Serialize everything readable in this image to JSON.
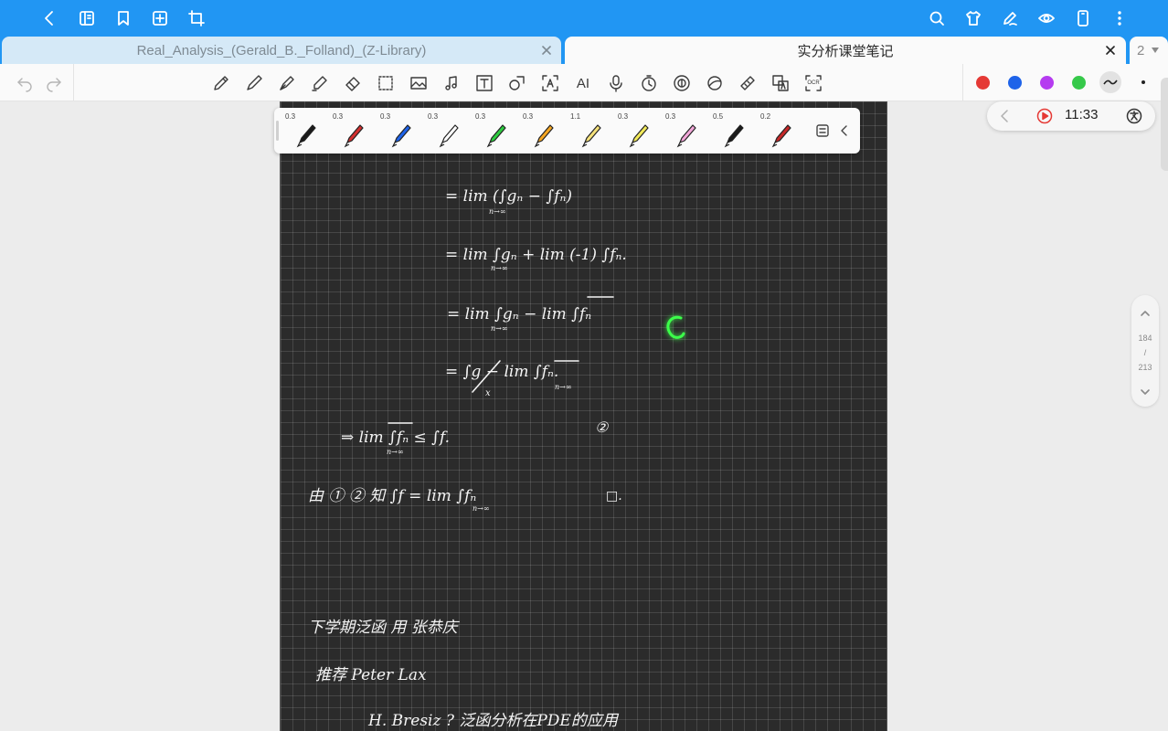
{
  "tabs": {
    "inactive_title": "Real_Analysis_(Gerald_B._Folland)_(Z-Library)",
    "active_title": "实分析课堂笔记",
    "extra_count": "2"
  },
  "toolbar": {
    "icons": [
      "back-icon",
      "library-icon",
      "bookmark-icon",
      "add-page-icon",
      "crop-icon",
      "search-icon",
      "theme-icon",
      "pen-mode-icon",
      "view-icon",
      "phone-icon",
      "more-icon"
    ]
  },
  "tools": {
    "icons": [
      "undo-icon",
      "redo-icon",
      "pencil-icon",
      "pen-icon",
      "fountain-pen-icon",
      "highlighter-icon",
      "eraser-icon",
      "lasso-icon",
      "image-icon",
      "audio-icon",
      "textbox-icon",
      "shapes-icon",
      "text-recognize-icon",
      "ai-icon",
      "microphone-icon",
      "timer-icon",
      "sticker-icon",
      "laser-pointer-icon",
      "ruler-icon",
      "translate-icon",
      "ocr-icon"
    ],
    "ai_label": "AI",
    "ocr_label": "OCR",
    "colors": [
      "#e53935",
      "#1e63e9",
      "#b53bf0",
      "#36c94a"
    ]
  },
  "pens": [
    {
      "size": "0.3",
      "color": "#1a1a1a"
    },
    {
      "size": "0.3",
      "color": "#d32f2f"
    },
    {
      "size": "0.3",
      "color": "#1e63e9"
    },
    {
      "size": "0.3",
      "color": "#ffffff"
    },
    {
      "size": "0.3",
      "color": "#2ecc40"
    },
    {
      "size": "0.3",
      "color": "#f5a623"
    },
    {
      "size": "1.1",
      "color": "#f5e17a"
    },
    {
      "size": "0.3",
      "color": "#f2ea5a"
    },
    {
      "size": "0.3",
      "color": "#f2a7d9"
    },
    {
      "size": "0.5",
      "color": "#1a1a1a"
    },
    {
      "size": "0.2",
      "color": "#c62828"
    }
  ],
  "player": {
    "time": "11:33"
  },
  "pagenav": {
    "current": "184",
    "sep": "/",
    "total": "213"
  },
  "note": {
    "line1": "=  lim (∫gₙ − ∫fₙ)",
    "line1_sub": "n→∞",
    "line2": "=  lim ∫gₙ + lim (-1) ∫fₙ.",
    "line2_sub": "n→∞",
    "line3": "=  lim ∫gₙ −  lim ∫fₙ",
    "line3_sub": "n→∞",
    "line4": "=  ∫g  −  lim ∫fₙ.",
    "line4_sub": "n→∞",
    "line4_x": "x",
    "line5": "⇒  lim ∫fₙ  ≤  ∫f.",
    "line5_sub": "n→∞",
    "circle2": "②",
    "line6": "由 ① ② 知  ∫f  =  lim ∫fₙ",
    "line6_sub": "n→∞",
    "qed": "□.",
    "line7": "下学期泛函 用 张恭庆",
    "line8": "推荐  Peter  Lax",
    "line9": "H. Bresiz ?     泛函分析在PDE的应用"
  }
}
